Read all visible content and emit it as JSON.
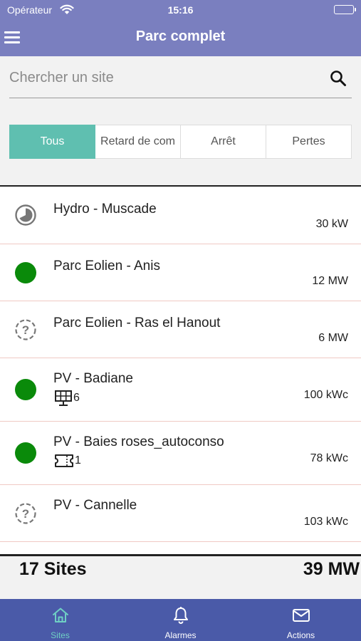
{
  "status_bar": {
    "carrier": "Opérateur",
    "time": "15:16"
  },
  "header": {
    "title": "Parc complet",
    "menu_icon": "hamburger-menu-icon",
    "background_color": "#7a7fbf"
  },
  "search": {
    "placeholder": "Chercher un site",
    "value": "",
    "icon": "search-icon"
  },
  "filters": {
    "selected": "Tous",
    "active_color": "#5fbfb0",
    "items": [
      {
        "label": "Tous"
      },
      {
        "label": "Retard de com"
      },
      {
        "label": "Arrêt"
      },
      {
        "label": "Pertes"
      }
    ]
  },
  "sites": [
    {
      "name": "Hydro - Muscade",
      "power": "30 kW",
      "status_icon": "partial-clock-icon"
    },
    {
      "name": "Parc Eolien - Anis",
      "power": "12 MW",
      "status_icon": "green-status-dot-icon"
    },
    {
      "name": "Parc Eolien - Ras el Hanout",
      "power": "6 MW",
      "status_icon": "unknown-status-icon"
    },
    {
      "name": "PV - Badiane",
      "power": "100 kWc",
      "status_icon": "green-status-dot-icon",
      "badge_icon": "solar-panel-icon",
      "badge_count": "6"
    },
    {
      "name": "PV - Baies roses_autoconso",
      "power": "78 kWc",
      "status_icon": "green-status-dot-icon",
      "badge_icon": "ticket-icon",
      "badge_count": "1"
    },
    {
      "name": "PV - Cannelle",
      "power": "103 kWc",
      "status_icon": "unknown-status-icon"
    }
  ],
  "totals": {
    "sites": "17 Sites",
    "power": "39 MW"
  },
  "tabbar": {
    "background_color": "#4a5aa8",
    "active_color": "#6fd0c4",
    "tabs": [
      {
        "label": "Sites",
        "icon": "home-icon"
      },
      {
        "label": "Alarmes",
        "icon": "bell-icon"
      },
      {
        "label": "Actions",
        "icon": "mail-icon"
      }
    ]
  },
  "colors": {
    "status_green": "#0a8a0a",
    "row_divider": "#f0c9c4"
  }
}
